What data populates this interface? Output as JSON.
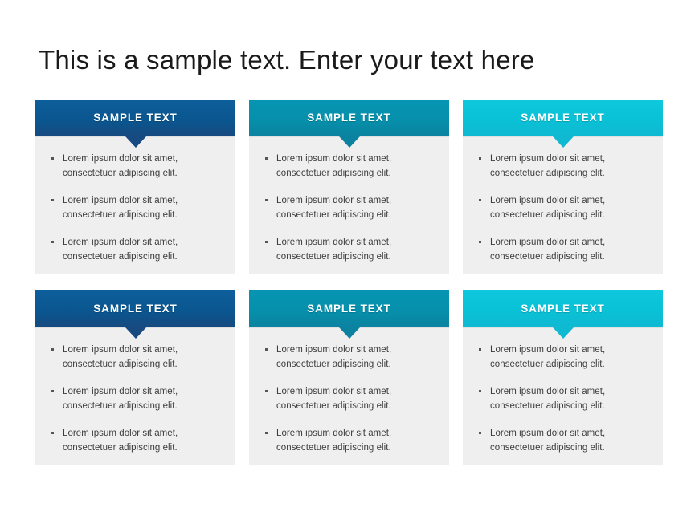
{
  "slide": {
    "title": "This is a sample text. Enter your text here",
    "background_color": "#ffffff"
  },
  "theme": {
    "body_background": "#efefef",
    "body_text_color": "#3d3d3d",
    "header_text_color": "#ffffff",
    "accent_blue": "#0a5690",
    "accent_teal": "#0690ab",
    "accent_cyan": "#0ac1d6"
  },
  "bullet_text": "Lorem ipsum dolor sit amet, consectetuer adipiscing elit.",
  "cards": [
    {
      "header": "SAMPLE TEXT",
      "color": "#0a5690",
      "color_name": "blue",
      "bullets": [
        "Lorem ipsum dolor sit amet, consectetuer adipiscing elit.",
        "Lorem ipsum dolor sit amet, consectetuer adipiscing elit.",
        "Lorem ipsum dolor sit amet, consectetuer adipiscing elit."
      ]
    },
    {
      "header": "SAMPLE TEXT",
      "color": "#0690ab",
      "color_name": "teal",
      "bullets": [
        "Lorem ipsum dolor sit amet, consectetuer adipiscing elit.",
        "Lorem ipsum dolor sit amet, consectetuer adipiscing elit.",
        "Lorem ipsum dolor sit amet, consectetuer adipiscing elit."
      ]
    },
    {
      "header": "SAMPLE TEXT",
      "color": "#0ac1d6",
      "color_name": "cyan",
      "bullets": [
        "Lorem ipsum dolor sit amet, consectetuer adipiscing elit.",
        "Lorem ipsum dolor sit amet, consectetuer adipiscing elit.",
        "Lorem ipsum dolor sit amet, consectetuer adipiscing elit."
      ]
    },
    {
      "header": "SAMPLE TEXT",
      "color": "#0a5690",
      "color_name": "blue",
      "bullets": [
        "Lorem ipsum dolor sit amet, consectetuer adipiscing elit.",
        "Lorem ipsum dolor sit amet, consectetuer adipiscing elit.",
        "Lorem ipsum dolor sit amet, consectetuer adipiscing elit."
      ]
    },
    {
      "header": "SAMPLE TEXT",
      "color": "#0690ab",
      "color_name": "teal",
      "bullets": [
        "Lorem ipsum dolor sit amet, consectetuer adipiscing elit.",
        "Lorem ipsum dolor sit amet, consectetuer adipiscing elit.",
        "Lorem ipsum dolor sit amet, consectetuer adipiscing elit."
      ]
    },
    {
      "header": "SAMPLE TEXT",
      "color": "#0ac1d6",
      "color_name": "cyan",
      "bullets": [
        "Lorem ipsum dolor sit amet, consectetuer adipiscing elit.",
        "Lorem ipsum dolor sit amet, consectetuer adipiscing elit.",
        "Lorem ipsum dolor sit amet, consectetuer adipiscing elit."
      ]
    }
  ]
}
